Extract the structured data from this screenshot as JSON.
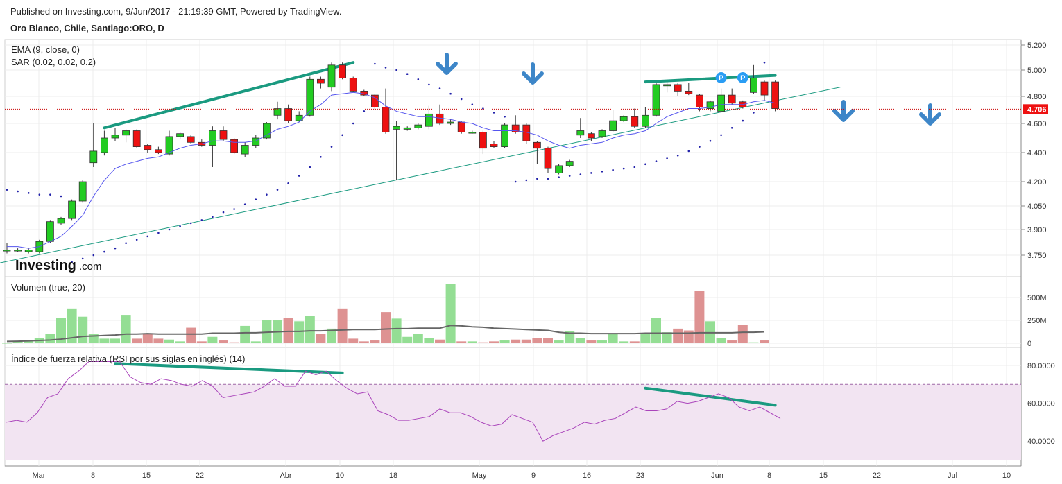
{
  "header": {
    "published": "Published on Investing.com, 9/Jun/2017 - 21:19:39 GMT, Powered by TradingView.",
    "symbol": "Oro Blanco, Chile, Santiago:ORO, D"
  },
  "watermark": {
    "brand": "Investing",
    "suffix": ".com"
  },
  "colors": {
    "up": "#22cc22",
    "down": "#ee1111",
    "ema": "#5555ee",
    "sar": "#2222aa",
    "trend": "#1a9a80",
    "arrow": "#3d86c8",
    "rsi": "#aa44bb",
    "rsi_band": "#f2e4f2"
  },
  "chart_data": [
    {
      "type": "candlestick",
      "title": "Oro Blanco, Chile, Santiago:ORO, D",
      "indicators": [
        "EMA (9, close, 0)",
        "SAR (0.02, 0.02, 0.2)"
      ],
      "last_price_label": "4.706",
      "y_ticks": [
        "5.200",
        "5.000",
        "4.800",
        "4.600",
        "4.400",
        "4.200",
        "4.050",
        "3.900",
        "3.750"
      ],
      "x_ticks": [
        "Mar",
        "8",
        "15",
        "22",
        "Abr",
        "10",
        "18",
        "May",
        "9",
        "16",
        "23",
        "Jun",
        "8",
        "15",
        "22",
        "Jul",
        "10"
      ],
      "candles": [
        [
          3.78,
          3.78,
          3.82,
          3.76
        ],
        [
          3.78,
          3.78,
          3.79,
          3.77
        ],
        [
          3.77,
          3.78,
          3.79,
          3.76
        ],
        [
          3.77,
          3.83,
          3.84,
          3.76
        ],
        [
          3.83,
          3.95,
          3.96,
          3.82
        ],
        [
          3.94,
          3.97,
          3.98,
          3.93
        ],
        [
          3.97,
          4.08,
          4.09,
          3.96
        ],
        [
          4.08,
          4.2,
          4.21,
          4.07
        ],
        [
          4.33,
          4.41,
          4.6,
          4.3
        ],
        [
          4.4,
          4.5,
          4.55,
          4.38
        ],
        [
          4.5,
          4.52,
          4.57,
          4.48
        ],
        [
          4.52,
          4.55,
          4.56,
          4.47
        ],
        [
          4.55,
          4.44,
          4.56,
          4.43
        ],
        [
          4.45,
          4.42,
          4.46,
          4.4
        ],
        [
          4.42,
          4.4,
          4.44,
          4.39
        ],
        [
          4.39,
          4.51,
          4.55,
          4.38
        ],
        [
          4.51,
          4.53,
          4.54,
          4.49
        ],
        [
          4.51,
          4.47,
          4.52,
          4.46
        ],
        [
          4.47,
          4.45,
          4.49,
          4.44
        ],
        [
          4.45,
          4.55,
          4.58,
          4.3
        ],
        [
          4.55,
          4.49,
          4.58,
          4.48
        ],
        [
          4.49,
          4.4,
          4.5,
          4.39
        ],
        [
          4.39,
          4.45,
          4.47,
          4.37
        ],
        [
          4.45,
          4.5,
          4.52,
          4.43
        ],
        [
          4.5,
          4.6,
          4.61,
          4.49
        ],
        [
          4.66,
          4.71,
          4.76,
          4.63
        ],
        [
          4.71,
          4.62,
          4.74,
          4.6
        ],
        [
          4.62,
          4.66,
          4.69,
          4.61
        ],
        [
          4.66,
          4.93,
          4.95,
          4.65
        ],
        [
          4.93,
          4.9,
          4.95,
          4.86
        ],
        [
          4.87,
          5.04,
          5.06,
          4.84
        ],
        [
          5.04,
          4.94,
          5.06,
          4.93
        ],
        [
          4.94,
          4.84,
          4.95,
          4.83
        ],
        [
          4.84,
          4.81,
          4.85,
          4.8
        ],
        [
          4.81,
          4.72,
          4.82,
          4.7
        ],
        [
          4.72,
          4.54,
          4.86,
          4.53
        ],
        [
          4.56,
          4.58,
          4.62,
          4.21
        ],
        [
          4.56,
          4.57,
          4.58,
          4.55
        ],
        [
          4.57,
          4.59,
          4.6,
          4.56
        ],
        [
          4.58,
          4.67,
          4.73,
          4.56
        ],
        [
          4.67,
          4.6,
          4.74,
          4.59
        ],
        [
          4.6,
          4.61,
          4.63,
          4.59
        ],
        [
          4.61,
          4.54,
          4.62,
          4.53
        ],
        [
          4.54,
          4.54,
          4.55,
          4.53
        ],
        [
          4.54,
          4.43,
          4.55,
          4.39
        ],
        [
          4.46,
          4.44,
          4.48,
          4.43
        ],
        [
          4.44,
          4.59,
          4.6,
          4.43
        ],
        [
          4.59,
          4.54,
          4.66,
          4.53
        ],
        [
          4.59,
          4.48,
          4.6,
          4.46
        ],
        [
          4.47,
          4.43,
          4.48,
          4.32
        ],
        [
          4.43,
          4.29,
          4.44,
          4.26
        ],
        [
          4.26,
          4.31,
          4.32,
          4.25
        ],
        [
          4.31,
          4.34,
          4.35,
          4.3
        ],
        [
          4.52,
          4.55,
          4.64,
          4.5
        ],
        [
          4.53,
          4.5,
          4.54,
          4.48
        ],
        [
          4.51,
          4.55,
          4.56,
          4.5
        ],
        [
          4.55,
          4.62,
          4.7,
          4.54
        ],
        [
          4.62,
          4.65,
          4.66,
          4.61
        ],
        [
          4.65,
          4.58,
          4.71,
          4.57
        ],
        [
          4.58,
          4.66,
          4.72,
          4.57
        ],
        [
          4.66,
          4.89,
          4.9,
          4.65
        ],
        [
          4.88,
          4.89,
          4.91,
          4.83
        ],
        [
          4.89,
          4.84,
          4.9,
          4.8
        ],
        [
          4.84,
          4.82,
          4.9,
          4.81
        ],
        [
          4.81,
          4.72,
          4.82,
          4.69
        ],
        [
          4.71,
          4.76,
          4.77,
          4.69
        ],
        [
          4.69,
          4.81,
          4.86,
          4.68
        ],
        [
          4.81,
          4.75,
          4.86,
          4.74
        ],
        [
          4.76,
          4.72,
          4.77,
          4.71
        ],
        [
          4.83,
          4.94,
          5.04,
          4.82
        ],
        [
          4.91,
          4.81,
          4.92,
          4.77
        ],
        [
          4.91,
          4.71,
          4.92,
          4.69
        ]
      ],
      "ema": [
        3.8,
        3.8,
        3.79,
        3.8,
        3.83,
        3.86,
        3.92,
        3.99,
        4.11,
        4.21,
        4.29,
        4.32,
        4.34,
        4.36,
        4.37,
        4.4,
        4.43,
        4.45,
        4.46,
        4.48,
        4.48,
        4.47,
        4.47,
        4.48,
        4.52,
        4.56,
        4.58,
        4.61,
        4.69,
        4.74,
        4.81,
        4.82,
        4.83,
        4.82,
        4.79,
        4.73,
        4.69,
        4.67,
        4.65,
        4.65,
        4.64,
        4.63,
        4.61,
        4.6,
        4.57,
        4.55,
        4.55,
        4.55,
        4.54,
        4.52,
        4.48,
        4.45,
        4.43,
        4.45,
        4.46,
        4.47,
        4.5,
        4.52,
        4.53,
        4.55,
        4.6,
        4.65,
        4.68,
        4.71,
        4.71,
        4.72,
        4.74,
        4.74,
        4.74,
        4.76,
        4.77,
        4.75
      ],
      "sar_x": [
        0,
        1,
        2,
        3,
        4,
        5,
        6,
        7,
        8,
        9,
        10,
        11,
        12,
        13,
        14,
        15,
        16,
        17,
        18,
        19,
        20,
        21,
        22,
        23,
        24,
        25,
        26,
        27,
        28,
        29,
        30,
        31,
        32,
        33,
        34,
        35,
        36,
        37,
        38,
        39,
        40,
        41,
        42,
        43,
        44,
        45,
        46,
        47,
        48,
        49,
        50,
        51,
        52,
        53,
        54,
        55,
        56,
        57,
        58,
        59,
        60,
        61,
        62,
        63,
        64,
        65,
        66,
        67,
        68,
        69,
        70
      ],
      "sar": [
        4.15,
        4.14,
        4.13,
        4.12,
        4.12,
        4.11,
        3.71,
        3.73,
        3.75,
        3.77,
        3.79,
        3.82,
        3.84,
        3.86,
        3.88,
        3.9,
        3.92,
        3.94,
        3.96,
        3.98,
        4.01,
        4.03,
        4.06,
        4.09,
        4.12,
        4.15,
        4.19,
        4.24,
        4.3,
        4.37,
        4.44,
        4.52,
        4.6,
        4.69,
        5.05,
        5.02,
        5.0,
        4.97,
        4.93,
        4.89,
        4.86,
        4.82,
        4.78,
        4.74,
        4.71,
        4.68,
        4.65,
        4.2,
        4.21,
        4.22,
        4.22,
        4.23,
        4.24,
        4.25,
        4.26,
        4.27,
        4.28,
        4.29,
        4.3,
        4.32,
        4.34,
        4.36,
        4.38,
        4.41,
        4.44,
        4.48,
        4.52,
        4.57,
        4.62,
        4.68,
        5.06
      ],
      "markers": [
        {
          "x": 66,
          "label": "P"
        },
        {
          "x": 68,
          "label": "P"
        }
      ]
    },
    {
      "type": "bar",
      "title": "Volumen (true, 20)",
      "y_ticks": [
        "500M",
        "250M",
        "0"
      ],
      "values_m": [
        0,
        20,
        30,
        60,
        100,
        280,
        380,
        290,
        100,
        50,
        50,
        310,
        50,
        100,
        50,
        40,
        20,
        170,
        20,
        70,
        30,
        10,
        190,
        20,
        250,
        250,
        280,
        240,
        300,
        100,
        160,
        380,
        50,
        20,
        30,
        340,
        270,
        70,
        100,
        60,
        40,
        650,
        20,
        20,
        10,
        20,
        30,
        40,
        40,
        60,
        60,
        30,
        130,
        60,
        30,
        30,
        110,
        20,
        20,
        100,
        280,
        120,
        160,
        140,
        570,
        240,
        60,
        30,
        200,
        10,
        30
      ],
      "ma_m": [
        20,
        22,
        26,
        30,
        35,
        45,
        60,
        75,
        80,
        85,
        90,
        100,
        100,
        105,
        100,
        100,
        100,
        100,
        100,
        110,
        110,
        110,
        115,
        115,
        120,
        125,
        130,
        130,
        135,
        135,
        140,
        145,
        150,
        150,
        150,
        155,
        160,
        160,
        165,
        165,
        165,
        195,
        190,
        180,
        175,
        165,
        160,
        155,
        150,
        145,
        140,
        120,
        110,
        110,
        105,
        105,
        105,
        105,
        105,
        110,
        110,
        110,
        110,
        110,
        115,
        115,
        115,
        115,
        120,
        120,
        125
      ]
    },
    {
      "type": "line",
      "title": "Índice de fuerza relativa (RSI por sus siglas en inglés) (14)",
      "y_ticks": [
        "80.0000",
        "60.0000",
        "40.0000"
      ],
      "band": [
        30,
        70
      ],
      "values": [
        50,
        51,
        50,
        55,
        63,
        65,
        73,
        77,
        82,
        82,
        82,
        82,
        74,
        71,
        70,
        73,
        72,
        70,
        69,
        72,
        69,
        63,
        64,
        65,
        66,
        69,
        73,
        69,
        69,
        77,
        75,
        77,
        72,
        68,
        65,
        66,
        56,
        54,
        51,
        51,
        52,
        53,
        57,
        55,
        55,
        53,
        50,
        48,
        49,
        54,
        52,
        50,
        40,
        43,
        45,
        47,
        50,
        49,
        51,
        52,
        55,
        58,
        56,
        56,
        57,
        61,
        60,
        61,
        63,
        65,
        63,
        58,
        56,
        58,
        55,
        52
      ],
      "trendlines_desc": "declining highs"
    }
  ],
  "trendlines": [
    {
      "panel": "price",
      "from": [
        9,
        4.57
      ],
      "to": [
        32,
        5.06
      ]
    },
    {
      "panel": "price",
      "from": [
        -1,
        3.7
      ],
      "to": [
        77,
        4.87
      ]
    },
    {
      "panel": "price",
      "from": [
        59,
        4.91
      ],
      "to": [
        71,
        4.96
      ]
    },
    {
      "panel": "rsi",
      "from": [
        10,
        81
      ],
      "to": [
        31,
        76
      ]
    },
    {
      "panel": "rsi",
      "from": [
        59,
        68
      ],
      "to": [
        71,
        59
      ]
    }
  ]
}
